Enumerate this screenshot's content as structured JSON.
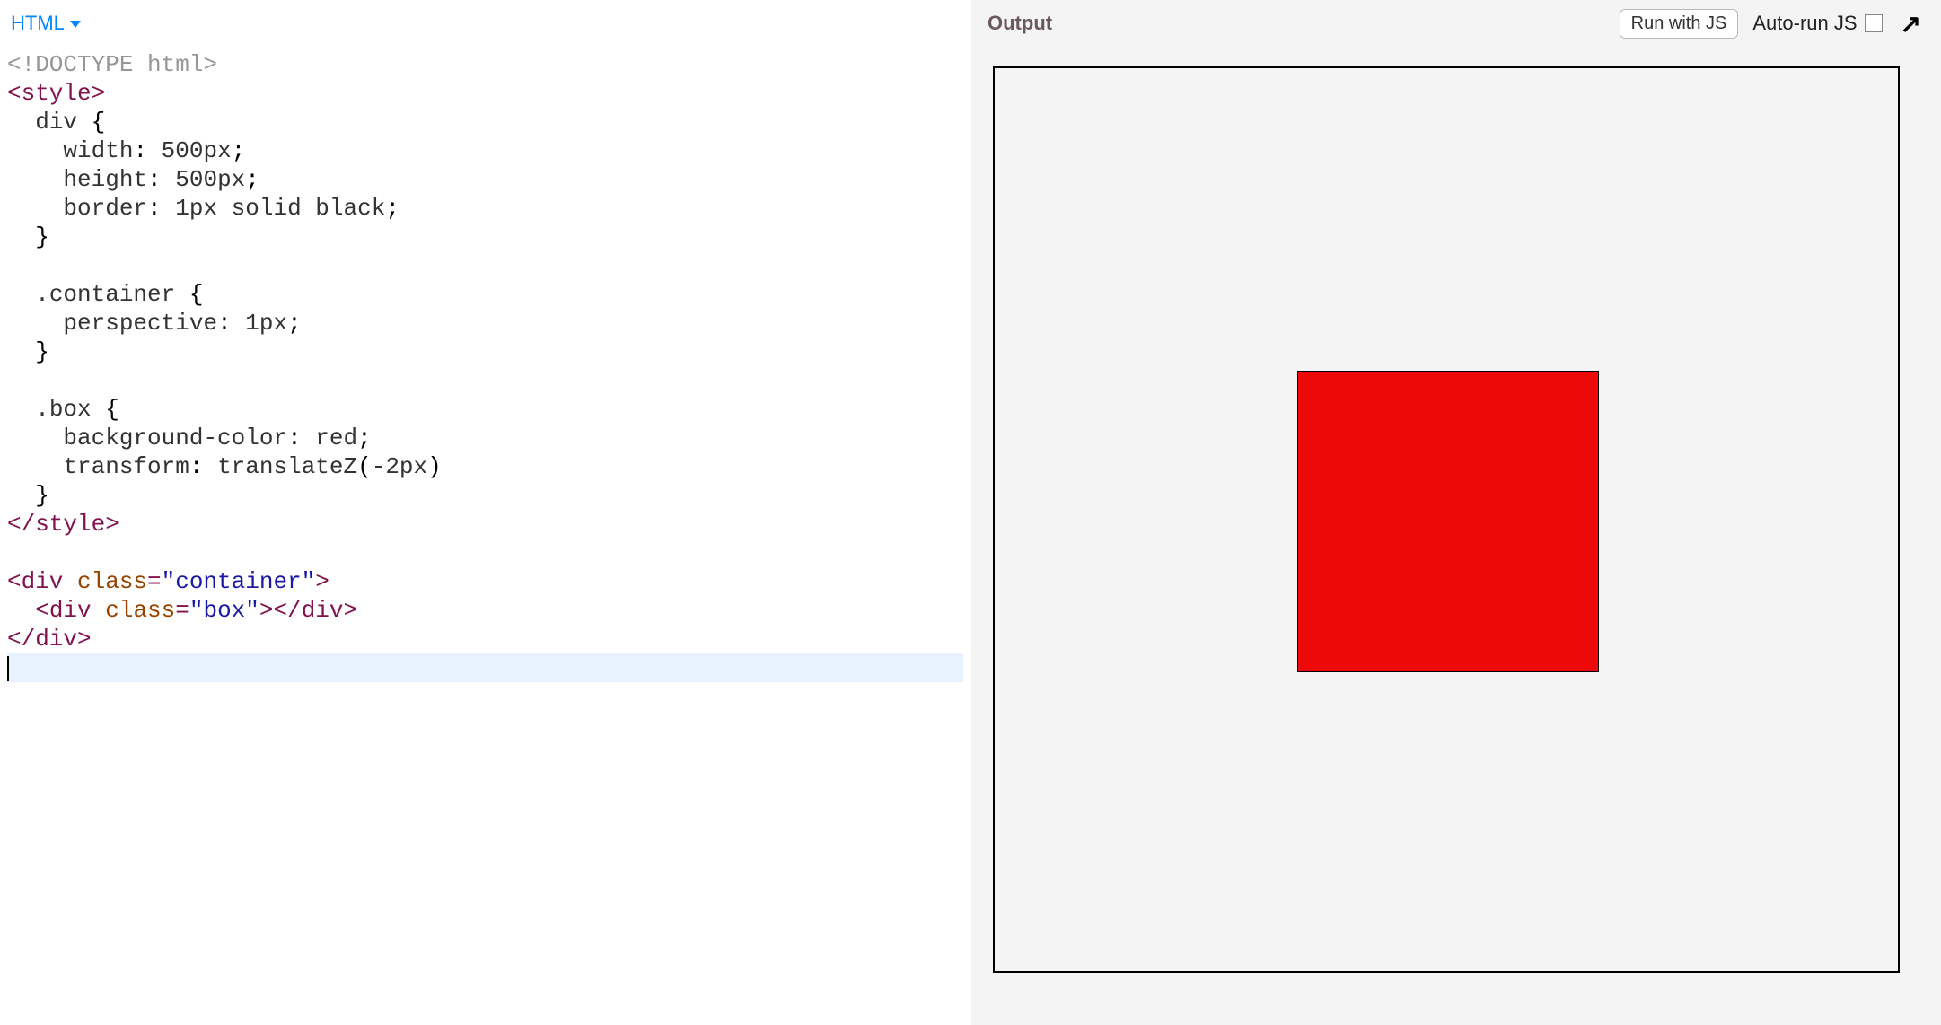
{
  "editor": {
    "language_dropdown": "HTML",
    "code_lines": [
      [
        {
          "t": "<!DOCTYPE html>",
          "c": "c-doctype"
        }
      ],
      [
        {
          "t": "<style>",
          "c": "c-tag"
        }
      ],
      [
        {
          "t": "  ",
          "c": ""
        },
        {
          "t": "div",
          "c": "c-selector"
        },
        {
          "t": " {",
          "c": ""
        }
      ],
      [
        {
          "t": "    ",
          "c": ""
        },
        {
          "t": "width",
          "c": "c-prop"
        },
        {
          "t": ": ",
          "c": ""
        },
        {
          "t": "500px",
          "c": "c-value"
        },
        {
          "t": ";",
          "c": ""
        }
      ],
      [
        {
          "t": "    ",
          "c": ""
        },
        {
          "t": "height",
          "c": "c-prop"
        },
        {
          "t": ": ",
          "c": ""
        },
        {
          "t": "500px",
          "c": "c-value"
        },
        {
          "t": ";",
          "c": ""
        }
      ],
      [
        {
          "t": "    ",
          "c": ""
        },
        {
          "t": "border",
          "c": "c-prop"
        },
        {
          "t": ": ",
          "c": ""
        },
        {
          "t": "1px solid black",
          "c": "c-value"
        },
        {
          "t": ";",
          "c": ""
        }
      ],
      [
        {
          "t": "  }",
          "c": ""
        }
      ],
      [
        {
          "t": "",
          "c": ""
        }
      ],
      [
        {
          "t": "  ",
          "c": ""
        },
        {
          "t": ".container",
          "c": "c-selector"
        },
        {
          "t": " {",
          "c": ""
        }
      ],
      [
        {
          "t": "    ",
          "c": ""
        },
        {
          "t": "perspective",
          "c": "c-prop"
        },
        {
          "t": ": ",
          "c": ""
        },
        {
          "t": "1px",
          "c": "c-value"
        },
        {
          "t": ";",
          "c": ""
        }
      ],
      [
        {
          "t": "  }",
          "c": ""
        }
      ],
      [
        {
          "t": "",
          "c": ""
        }
      ],
      [
        {
          "t": "  ",
          "c": ""
        },
        {
          "t": ".box",
          "c": "c-selector"
        },
        {
          "t": " {",
          "c": ""
        }
      ],
      [
        {
          "t": "    ",
          "c": ""
        },
        {
          "t": "background-color",
          "c": "c-prop"
        },
        {
          "t": ": ",
          "c": ""
        },
        {
          "t": "red",
          "c": "c-value"
        },
        {
          "t": ";",
          "c": ""
        }
      ],
      [
        {
          "t": "    ",
          "c": ""
        },
        {
          "t": "transform",
          "c": "c-prop"
        },
        {
          "t": ": ",
          "c": ""
        },
        {
          "t": "translateZ",
          "c": "c-value"
        },
        {
          "t": "(",
          "c": ""
        },
        {
          "t": "-2px",
          "c": "c-value"
        },
        {
          "t": ")",
          "c": ""
        }
      ],
      [
        {
          "t": "  }",
          "c": ""
        }
      ],
      [
        {
          "t": "</style>",
          "c": "c-tag"
        }
      ],
      [
        {
          "t": "",
          "c": ""
        }
      ],
      [
        {
          "t": "<div ",
          "c": "c-tag"
        },
        {
          "t": "class",
          "c": "c-attr"
        },
        {
          "t": "=",
          "c": "c-tag"
        },
        {
          "t": "\"container\"",
          "c": "c-string"
        },
        {
          "t": ">",
          "c": "c-tag"
        }
      ],
      [
        {
          "t": "  ",
          "c": ""
        },
        {
          "t": "<div ",
          "c": "c-tag"
        },
        {
          "t": "class",
          "c": "c-attr"
        },
        {
          "t": "=",
          "c": "c-tag"
        },
        {
          "t": "\"box\"",
          "c": "c-string"
        },
        {
          "t": ">",
          "c": "c-tag"
        },
        {
          "t": "</div>",
          "c": "c-tag"
        }
      ],
      [
        {
          "t": "</div>",
          "c": "c-tag"
        }
      ]
    ]
  },
  "output": {
    "title": "Output",
    "run_button": "Run with JS",
    "autorun_label": "Auto-run JS",
    "expand_icon": "↗"
  },
  "colors": {
    "link_blue": "#0086ff",
    "tag_maroon": "#82134e",
    "attr_brown": "#994500",
    "string_blue": "#1a1aa6",
    "doctype_gray": "#979797",
    "output_bg": "#f4f4f4",
    "red_box": "#ee0909"
  }
}
